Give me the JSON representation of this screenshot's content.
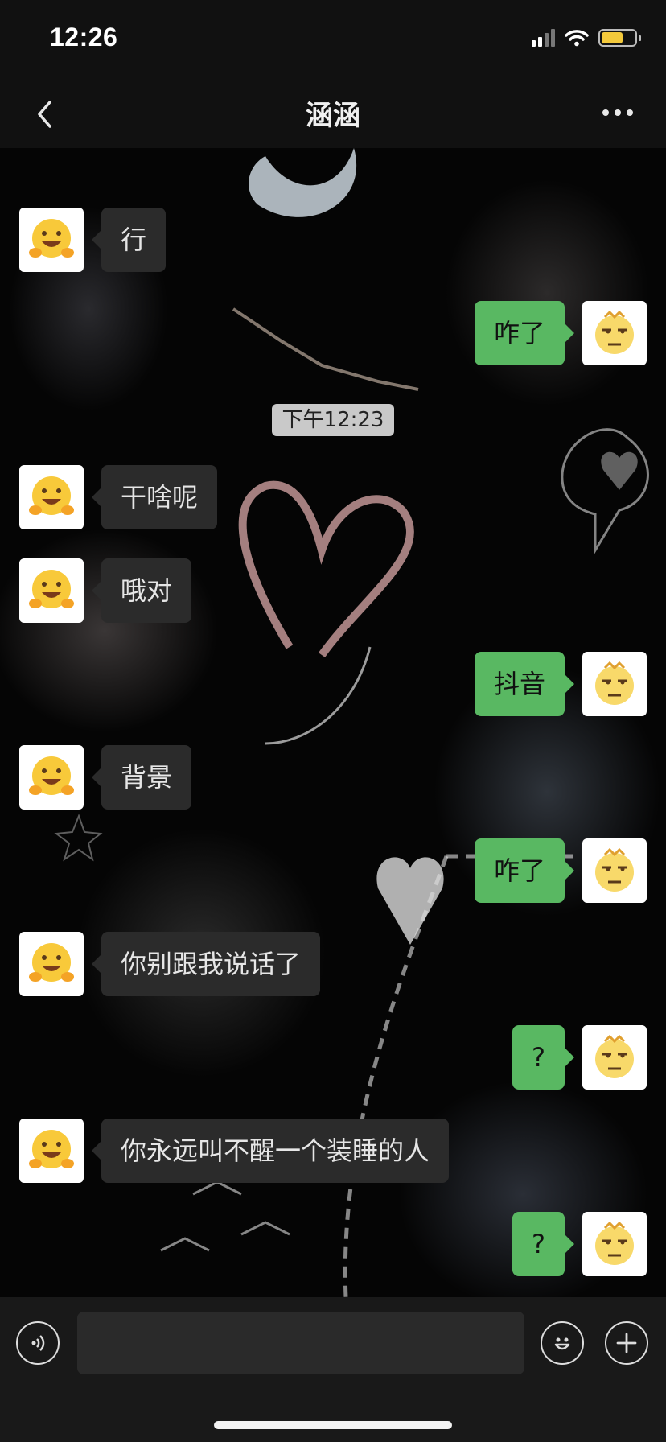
{
  "status_bar": {
    "time": "12:26"
  },
  "header": {
    "title": "涵涵"
  },
  "chat": {
    "timestamp": "下午12:23",
    "messages": [
      {
        "side": "left",
        "text": "行"
      },
      {
        "side": "right",
        "text": "咋了"
      },
      {
        "side": "left",
        "text": "干啥呢"
      },
      {
        "side": "left",
        "text": "哦对"
      },
      {
        "side": "right",
        "text": "抖音"
      },
      {
        "side": "left",
        "text": "背景"
      },
      {
        "side": "right",
        "text": "咋了"
      },
      {
        "side": "left",
        "text": "你别跟我说话了"
      },
      {
        "side": "right",
        "text": "?"
      },
      {
        "side": "left",
        "text": "你永远叫不醒一个装睡的人"
      },
      {
        "side": "right",
        "text": "?"
      }
    ]
  },
  "input_bar": {
    "placeholder": ""
  },
  "icons": {
    "back": "chevron-left-icon",
    "more": "more-dots-icon",
    "voice": "voice-icon",
    "emoji": "emoji-icon",
    "plus": "plus-icon",
    "contact_avatar": "hugging-face-emoji",
    "my_avatar": "unamused-face-emoji"
  },
  "colors": {
    "my_bubble": "#59b862",
    "their_bubble": "#2b2b2b",
    "battery": "#f3c93b"
  }
}
